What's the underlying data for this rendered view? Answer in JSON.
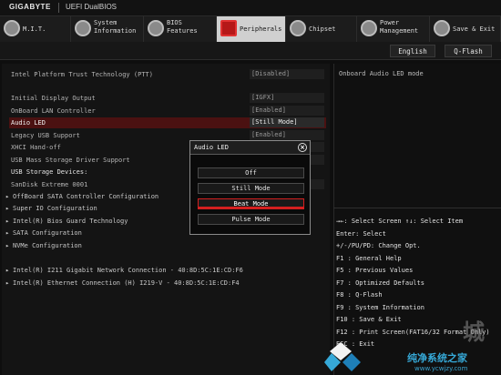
{
  "brand": {
    "name": "GIGABYTE",
    "subtitle": "UEFI DualBIOS"
  },
  "tabs": [
    {
      "label": "M.I.T.",
      "active": false
    },
    {
      "label": "System\nInformation",
      "active": false
    },
    {
      "label": "BIOS\nFeatures",
      "active": false
    },
    {
      "label": "Peripherals",
      "active": true
    },
    {
      "label": "Chipset",
      "active": false
    },
    {
      "label": "Power\nManagement",
      "active": false
    },
    {
      "label": "Save & Exit",
      "active": false
    }
  ],
  "subbar": {
    "language": "English",
    "qflash": "Q-Flash"
  },
  "settings": {
    "ptt": {
      "label": "Intel Platform Trust Technology (PTT)",
      "value": "[Disabled]"
    },
    "display": {
      "label": "Initial Display Output",
      "value": "[IGFX]"
    },
    "lan": {
      "label": "OnBoard LAN Controller",
      "value": "[Enabled]"
    },
    "audio": {
      "label": "Audio LED",
      "value": "[Still Mode]"
    },
    "legacy": {
      "label": "Legacy USB Support",
      "value": "[Enabled]"
    },
    "xhci": {
      "label": "XHCI Hand-off",
      "value": ""
    },
    "usbmass": {
      "label": "USB Mass Storage Driver Support",
      "value": ""
    },
    "usbdev_header": {
      "label": "USB Storage Devices:"
    },
    "sandisk": {
      "label": "SanDisk Extreme 0001",
      "value": ""
    }
  },
  "submenus": [
    "OffBoard SATA Controller Configuration",
    "Super IO Configuration",
    "Intel(R) Bios Guard Technology",
    "SATA Configuration",
    "NVMe Configuration",
    "Intel(R) I211 Gigabit  Network Connection - 40:8D:5C:1E:CD:F6",
    "Intel(R) Ethernet Connection (H) I219-V - 40:8D:5C:1E:CD:F4"
  ],
  "help": {
    "description": "Onboard Audio LED mode"
  },
  "keys": [
    "→←: Select Screen  ↑↓: Select Item",
    "Enter: Select",
    "+/-/PU/PD: Change Opt.",
    "F1  : General Help",
    "F5  : Previous Values",
    "F7  : Optimized Defaults",
    "F8  : Q-Flash",
    "F9  : System Information",
    "F10 : Save & Exit",
    "F12 : Print Screen(FAT16/32 Format Only)",
    "ESC : Exit"
  ],
  "popup": {
    "title": "Audio LED",
    "options": [
      "Off",
      "Still Mode",
      "Beat Mode",
      "Pulse Mode"
    ],
    "selected_index": 2
  },
  "watermark": {
    "text": "纯净系统之家",
    "url": "www.ycwjzy.com",
    "big": "城"
  },
  "colors": {
    "accent": "#d42020",
    "highlight_row": "#4b1111",
    "watermark": "#36a9d8"
  }
}
